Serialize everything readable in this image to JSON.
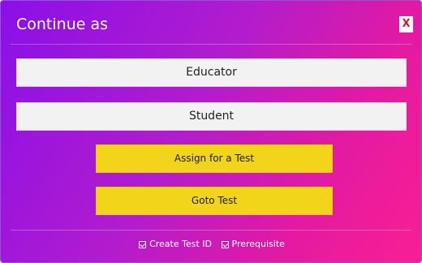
{
  "dialog": {
    "title": "Continue as",
    "close_label": "X",
    "colors": {
      "gradient_start": "#8a10e8",
      "gradient_end": "#f91f92",
      "role_button": "#f2f2f2",
      "action_button": "#f2d51b",
      "close_text": "#e1191e"
    }
  },
  "buttons": {
    "educator": "Educator",
    "student": "Student",
    "assign_test": "Assign for a Test",
    "goto_test": "Goto Test"
  },
  "footer": {
    "options": [
      {
        "label": "Create Test ID",
        "checked": true,
        "icon": "checkbox-checked-icon"
      },
      {
        "label": "Prerequisite",
        "checked": true,
        "icon": "checkbox-checked-icon"
      }
    ]
  }
}
